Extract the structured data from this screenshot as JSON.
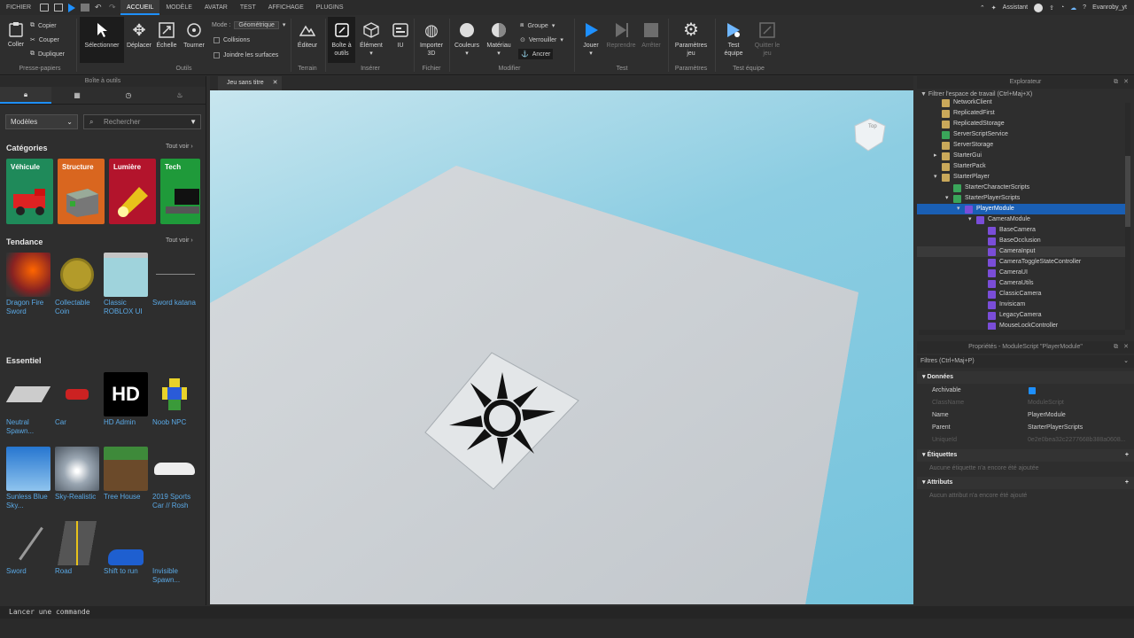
{
  "menubar": {
    "file": "FICHIER",
    "tabs": [
      "ACCUEIL",
      "MODÈLE",
      "AVATAR",
      "TEST",
      "AFFICHAGE",
      "PLUGINS"
    ],
    "active_tab": "ACCUEIL",
    "assistant": "Assistant",
    "user": "Evanroby_yt"
  },
  "ribbon": {
    "clipboard": {
      "paste": "Coller",
      "copy": "Copier",
      "cut": "Couper",
      "duplicate": "Dupliquer",
      "group": "Presse-papiers"
    },
    "tools": {
      "select": "Sélectionner",
      "move": "Déplacer",
      "scale": "Échelle",
      "rotate": "Tourner",
      "group": "Outils"
    },
    "mode": {
      "label": "Mode :",
      "value": "Géométrique",
      "collisions": "Collisions",
      "join": "Joindre les surfaces"
    },
    "terrain": {
      "editor": "Éditeur",
      "group": "Terrain"
    },
    "insert": {
      "toolbox": "Boîte à outils",
      "element": "Élément",
      "ui": "IU",
      "group": "Insérer"
    },
    "file": {
      "import3d": "Importer 3D",
      "group": "Fichier"
    },
    "modify": {
      "colors": "Couleurs",
      "material": "Matériau",
      "grouping": "Groupe",
      "lock": "Verrouiller",
      "anchor": "Ancrer",
      "group": "Modifier"
    },
    "test": {
      "play": "Jouer",
      "resume": "Reprendre",
      "stop": "Arrêter",
      "group": "Test"
    },
    "settings": {
      "label": "Paramètres jeu",
      "group": "Paramètres"
    },
    "team": {
      "test": "Test équipe",
      "quit": "Quitter le jeu",
      "group": "Test équipe"
    }
  },
  "toolbox": {
    "title": "Boîte à outils",
    "dropdown": "Modèles",
    "search_placeholder": "Rechercher",
    "categories_title": "Catégories",
    "see_all": "Tout voir",
    "categories": [
      {
        "label": "Véhicule",
        "color": "#1f8a5a"
      },
      {
        "label": "Structure",
        "color": "#d9661f"
      },
      {
        "label": "Lumière",
        "color": "#b3142c"
      },
      {
        "label": "Tech",
        "color": "#1f9a3a"
      }
    ],
    "trending_title": "Tendance",
    "trending": [
      "Dragon Fire Sword",
      "Collectable Coin",
      "Classic ROBLOX UI",
      "Sword katana"
    ],
    "essential_title": "Essentiel",
    "essential": [
      "Neutral Spawn...",
      "Car",
      "HD Admin",
      "Noob NPC",
      "Sunless Blue Sky...",
      "Sky-Realistic",
      "Tree House",
      "2019 Sports Car // Rosh",
      "Sword",
      "Road",
      "Shift to run",
      "Invisible Spawn..."
    ],
    "hd_text": "HD"
  },
  "viewport": {
    "tab": "Jeu sans titre",
    "cube_label": "Top"
  },
  "explorer": {
    "title": "Explorateur",
    "filter": "Filtrer l'espace de travail (Ctrl+Maj+X)",
    "rows": [
      {
        "label": "NetworkClient",
        "indent": 1,
        "arrow": ""
      },
      {
        "label": "ReplicatedFirst",
        "indent": 1,
        "arrow": ""
      },
      {
        "label": "ReplicatedStorage",
        "indent": 1,
        "arrow": ""
      },
      {
        "label": "ServerScriptService",
        "indent": 1,
        "arrow": ""
      },
      {
        "label": "ServerStorage",
        "indent": 1,
        "arrow": ""
      },
      {
        "label": "StarterGui",
        "indent": 1,
        "arrow": "▸"
      },
      {
        "label": "StarterPack",
        "indent": 1,
        "arrow": ""
      },
      {
        "label": "StarterPlayer",
        "indent": 1,
        "arrow": "▾"
      },
      {
        "label": "StarterCharacterScripts",
        "indent": 2,
        "arrow": ""
      },
      {
        "label": "StarterPlayerScripts",
        "indent": 2,
        "arrow": "▾"
      },
      {
        "label": "PlayerModule",
        "indent": 3,
        "arrow": "▾",
        "selected": true
      },
      {
        "label": "CameraModule",
        "indent": 4,
        "arrow": "▾"
      },
      {
        "label": "BaseCamera",
        "indent": 5,
        "arrow": ""
      },
      {
        "label": "BaseOcclusion",
        "indent": 5,
        "arrow": ""
      },
      {
        "label": "CameraInput",
        "indent": 5,
        "arrow": "",
        "hover": true
      },
      {
        "label": "CameraToggleStateController",
        "indent": 5,
        "arrow": ""
      },
      {
        "label": "CameraUI",
        "indent": 5,
        "arrow": ""
      },
      {
        "label": "CameraUtils",
        "indent": 5,
        "arrow": ""
      },
      {
        "label": "ClassicCamera",
        "indent": 5,
        "arrow": ""
      },
      {
        "label": "Invisicam",
        "indent": 5,
        "arrow": ""
      },
      {
        "label": "LegacyCamera",
        "indent": 5,
        "arrow": ""
      },
      {
        "label": "MouseLockController",
        "indent": 5,
        "arrow": ""
      }
    ]
  },
  "properties": {
    "title": "Propriétés - ModuleScript \"PlayerModule\"",
    "filter": "Filtres (Ctrl+Maj+P)",
    "data_section": "Données",
    "rows": [
      {
        "k": "Archivable",
        "v": "",
        "check": true
      },
      {
        "k": "ClassName",
        "v": "ModuleScript",
        "dim": true
      },
      {
        "k": "Name",
        "v": "PlayerModule"
      },
      {
        "k": "Parent",
        "v": "StarterPlayerScripts"
      },
      {
        "k": "UniqueId",
        "v": "0e2e0bea32c2277668b388a0608...",
        "dim": true
      }
    ],
    "tags_section": "Étiquettes",
    "tags_empty": "Aucune étiquette n'a encore été ajoutée",
    "attr_section": "Attributs",
    "attr_empty": "Aucun attribut n'a encore été ajouté"
  },
  "command": {
    "placeholder": "Lancer une commande"
  }
}
